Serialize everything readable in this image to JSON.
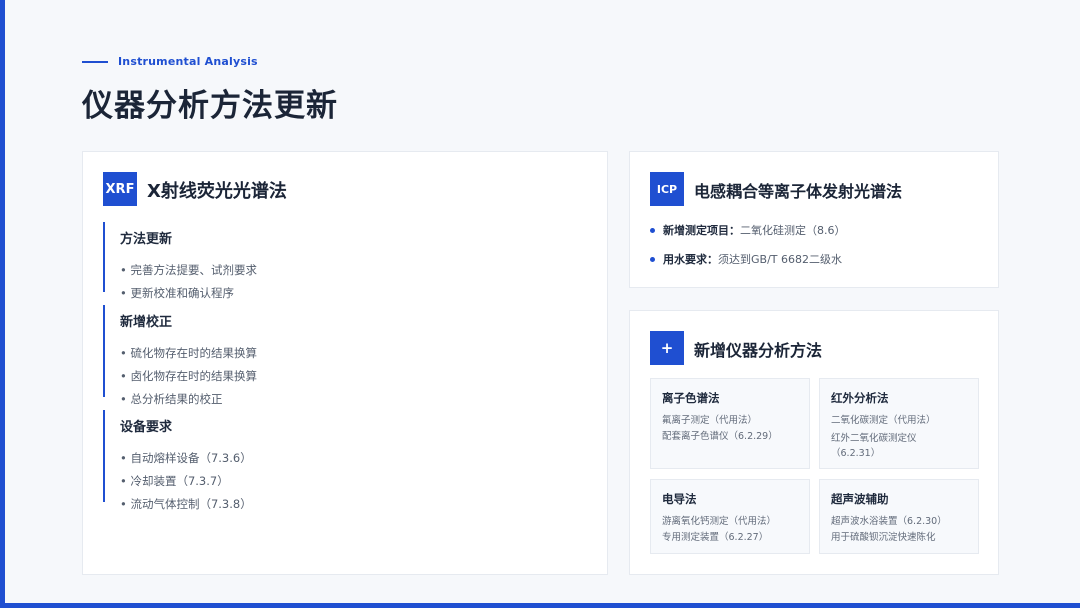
{
  "header": {
    "eyebrow": "Instrumental Analysis",
    "title": "仪器分析方法更新"
  },
  "colors": {
    "accent": "#1f4fd1"
  },
  "xrf": {
    "badge": "XRF",
    "title": "X射线荧光光谱法",
    "sections": [
      {
        "title": "方法更新",
        "items": [
          "• 完善方法提要、试剂要求",
          "• 更新校准和确认程序"
        ]
      },
      {
        "title": "新增校正",
        "items": [
          "• 硫化物存在时的结果换算",
          "• 卤化物存在时的结果换算",
          "• 总分析结果的校正"
        ]
      },
      {
        "title": "设备要求",
        "items": [
          "• 自动熔样设备（7.3.6）",
          "• 冷却装置（7.3.7）",
          "• 流动气体控制（7.3.8）"
        ]
      }
    ]
  },
  "icp": {
    "badge": "ICP",
    "title": "电感耦合等离子体发射光谱法",
    "rows": [
      {
        "key": "新增测定项目：",
        "value": "二氧化硅测定（8.6）"
      },
      {
        "key": "用水要求：",
        "value": "须达到GB/T 6682二级水"
      }
    ]
  },
  "new_methods": {
    "badge": "+",
    "title": "新增仪器分析方法",
    "cards": [
      {
        "title": "离子色谱法",
        "lines": [
          "氟离子测定（代用法）",
          "配套离子色谱仪（6.2.29）"
        ]
      },
      {
        "title": "红外分析法",
        "lines": [
          "二氧化碳测定（代用法）",
          "红外二氧化碳测定仪",
          "（6.2.31）"
        ]
      },
      {
        "title": "电导法",
        "lines": [
          "游离氧化钙测定（代用法）",
          "专用测定装置（6.2.27）"
        ]
      },
      {
        "title": "超声波辅助",
        "lines": [
          "超声波水浴装置（6.2.30）",
          "用于硫酸钡沉淀快速陈化"
        ]
      }
    ]
  }
}
